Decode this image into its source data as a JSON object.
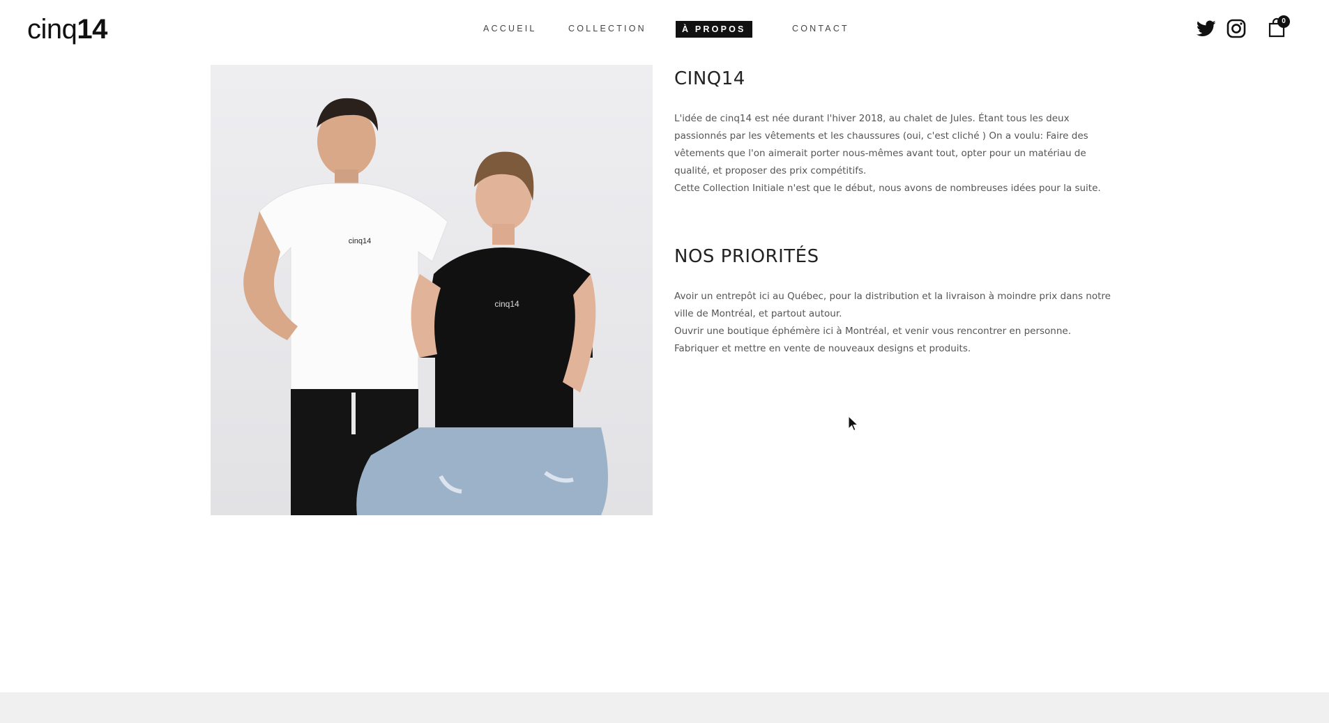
{
  "header": {
    "logo_light": "cinq",
    "logo_bold": "14",
    "nav": [
      {
        "label": "ACCUEIL"
      },
      {
        "label": "COLLECTION"
      },
      {
        "label": "À PROPOS"
      },
      {
        "label": "CONTACT"
      }
    ],
    "cart_count": "0",
    "icons": [
      "twitter-icon",
      "instagram-icon",
      "shopping-bag-icon"
    ]
  },
  "about": {
    "title": "CINQ14",
    "paragraphs": [
      "L'idée de cinq14 est née durant l'hiver 2018, au chalet de Jules. Étant tous les deux passionnés par les vêtements et les chaussures (oui, c'est cliché ) On a voulu: Faire des vêtements que l'on aimerait porter nous-mêmes avant tout, opter pour un matériau de qualité, et proposer des prix compétitifs.",
      "Cette Collection Initiale n'est que le début, nous avons de nombreuses idées pour la suite."
    ]
  },
  "priorities": {
    "title": "NOS PRIORITÉS",
    "paragraphs": [
      "Avoir un entrepôt ici au Québec, pour la distribution et la livraison à moindre prix dans notre ville de Montréal, et partout autour.",
      "Ouvrir une boutique éphémère ici à Montréal, et venir vous rencontrer en personne.",
      "Fabriquer et mettre en vente de nouveaux designs et produits."
    ]
  },
  "photo": {
    "tshirt_print_1": "cinq14",
    "tshirt_print_2": "cinq14"
  },
  "colors": {
    "accent": "#111111",
    "text": "#555555",
    "footer": "#f0f0f0"
  }
}
